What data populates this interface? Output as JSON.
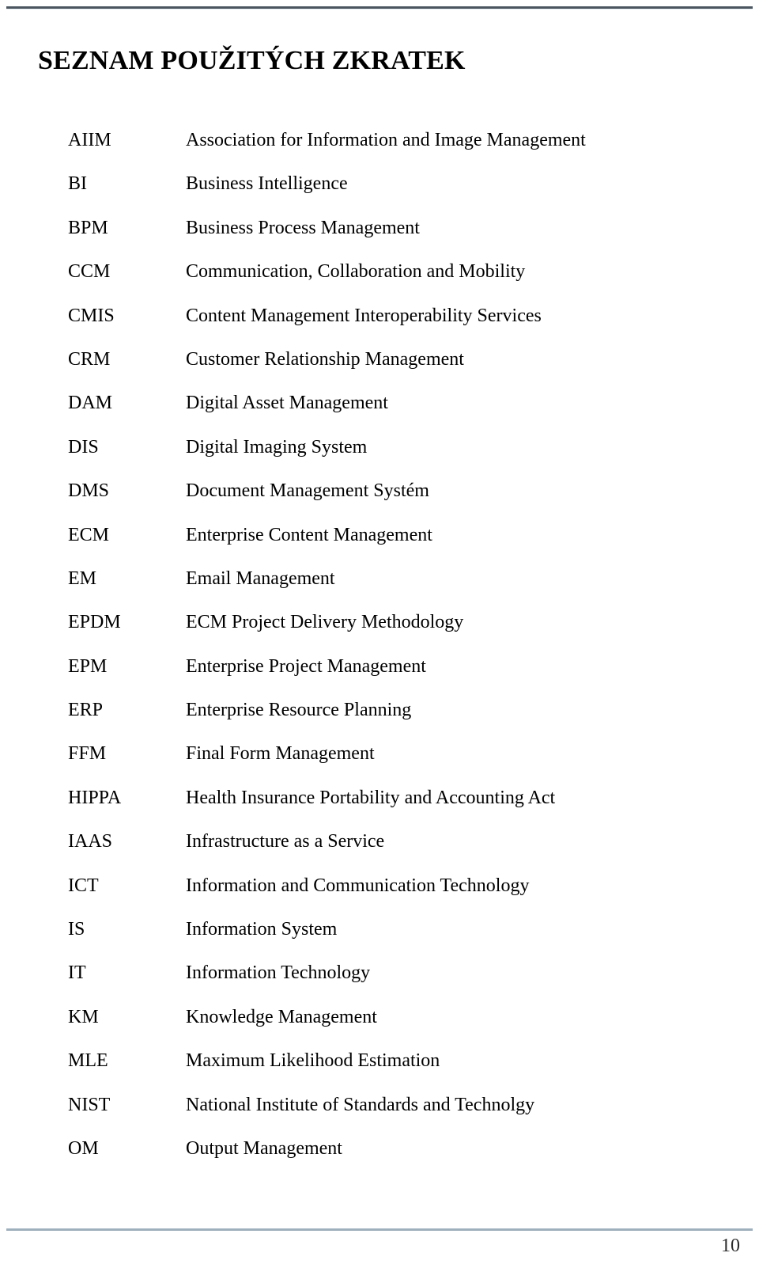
{
  "page": {
    "title": "SEZNAM POUŽITÝCH ZKRATEK",
    "page_number": "10",
    "rule_color_top": "#4a555f",
    "rule_color_bottom": "#9fb0bd",
    "text_color": "#000000",
    "background": "#ffffff"
  },
  "abbreviations": [
    {
      "term": "AIIM",
      "definition": "Association for Information and Image Management"
    },
    {
      "term": "BI",
      "definition": "Business Intelligence"
    },
    {
      "term": "BPM",
      "definition": "Business Process Management"
    },
    {
      "term": "CCM",
      "definition": "Communication, Collaboration and Mobility"
    },
    {
      "term": "CMIS",
      "definition": "Content Management Interoperability Services"
    },
    {
      "term": "CRM",
      "definition": "Customer Relationship Management"
    },
    {
      "term": "DAM",
      "definition": "Digital Asset Management"
    },
    {
      "term": "DIS",
      "definition": "Digital Imaging System"
    },
    {
      "term": "DMS",
      "definition": "Document Management Systém"
    },
    {
      "term": "ECM",
      "definition": "Enterprise Content Management"
    },
    {
      "term": "EM",
      "definition": "Email Management"
    },
    {
      "term": "EPDM",
      "definition": "ECM Project Delivery Methodology"
    },
    {
      "term": "EPM",
      "definition": "Enterprise Project Management"
    },
    {
      "term": "ERP",
      "definition": "Enterprise Resource Planning"
    },
    {
      "term": "FFM",
      "definition": "Final Form Management"
    },
    {
      "term": "HIPPA",
      "definition": "Health Insurance Portability and Accounting Act"
    },
    {
      "term": "IAAS",
      "definition": "Infrastructure as a Service"
    },
    {
      "term": "ICT",
      "definition": "Information and Communication Technology"
    },
    {
      "term": "IS",
      "definition": "Information System"
    },
    {
      "term": "IT",
      "definition": "Information Technology"
    },
    {
      "term": "KM",
      "definition": "Knowledge Management"
    },
    {
      "term": "MLE",
      "definition": "Maximum Likelihood Estimation"
    },
    {
      "term": "NIST",
      "definition": "National Institute of Standards and Technolgy"
    },
    {
      "term": "OM",
      "definition": "Output Management"
    }
  ]
}
